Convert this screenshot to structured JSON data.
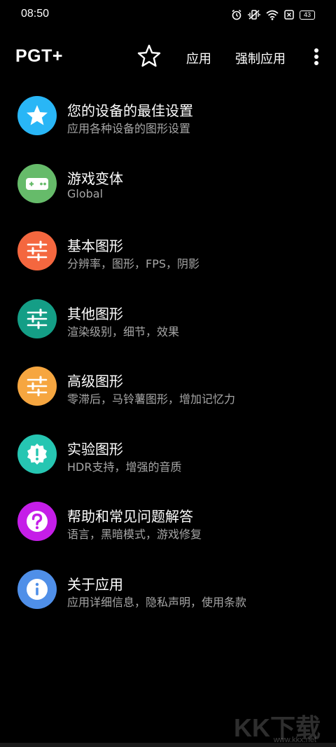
{
  "status_bar": {
    "time": "08:50",
    "battery": "43",
    "icons": [
      "alarm-icon",
      "vibrate-icon",
      "wifi-icon",
      "sim-icon",
      "battery-icon"
    ]
  },
  "app_bar": {
    "title": "PGT+",
    "star_icon": "star-outline-icon",
    "apply_label": "应用",
    "force_apply_label": "强制应用",
    "more_icon": "more-vert-icon"
  },
  "menu": {
    "items": [
      {
        "title": "您的设备的最佳设置",
        "subtitle": "应用各种设备的图形设置",
        "icon": "star-icon",
        "color": "#29b6f6"
      },
      {
        "title": "游戏变体",
        "subtitle": "Global",
        "icon": "gamepad-icon",
        "color": "#66bb6a"
      },
      {
        "title": "基本图形",
        "subtitle": "分辨率，图形，FPS，阴影",
        "icon": "sliders-icon",
        "color": "#f4673f"
      },
      {
        "title": "其他图形",
        "subtitle": "渲染级别，细节，效果",
        "icon": "sliders-icon",
        "color": "#149e86"
      },
      {
        "title": "高级图形",
        "subtitle": "零滞后，马铃薯图形，增加记忆力",
        "icon": "sliders-icon",
        "color": "#f6a640"
      },
      {
        "title": "实验图形",
        "subtitle": "HDR支持，增强的音质",
        "icon": "alert-badge-icon",
        "color": "#26c6b2"
      },
      {
        "title": "帮助和常见问题解答",
        "subtitle": "语言，黑暗模式，游戏修复",
        "icon": "help-icon",
        "color": "#c51ee8"
      },
      {
        "title": "关于应用",
        "subtitle": "应用详细信息，隐私声明，使用条款",
        "icon": "info-icon",
        "color": "#4f8fe8"
      }
    ]
  },
  "watermark": {
    "text": "KK下载",
    "url": "www.kkx.net"
  }
}
